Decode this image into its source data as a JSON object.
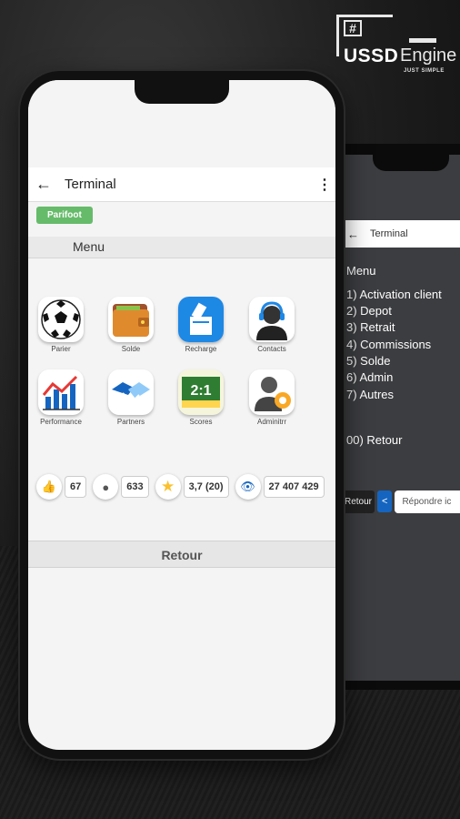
{
  "logo": {
    "hash": "#",
    "ussd": "USSD",
    "engine": "Engine",
    "tagline": "JUST SIMPLE"
  },
  "front": {
    "title": "Terminal",
    "chip": "Parifoot",
    "menu_label": "Menu",
    "tiles": [
      {
        "label": "Parier",
        "icon": "soccer-ball-icon"
      },
      {
        "label": "Solde",
        "icon": "wallet-icon"
      },
      {
        "label": "Recharge",
        "icon": "recharge-icon"
      },
      {
        "label": "Contacts",
        "icon": "headset-agent-icon"
      },
      {
        "label": "Performance",
        "icon": "bar-chart-icon"
      },
      {
        "label": "Partners",
        "icon": "handshake-icon"
      },
      {
        "label": "Scores",
        "icon": "scoreboard-icon"
      },
      {
        "label": "Adminitrr",
        "icon": "admin-gear-icon"
      }
    ],
    "scoreboard_text": "2:1",
    "stats": {
      "likes": "67",
      "users": "633",
      "rating": "3,7 (20)",
      "views": "27 407 429"
    },
    "retour": "Retour"
  },
  "back": {
    "title": "Terminal",
    "menu_title": "Menu",
    "options": [
      "1) Activation client",
      "2) Depot",
      "3) Retrait",
      "4) Commissions",
      "5) Solde",
      "6) Admin",
      "7) Autres"
    ],
    "exit_option": "00) Retour",
    "retour_button": "Retour",
    "back_button": "<",
    "reply_placeholder": "Répondre ic"
  }
}
